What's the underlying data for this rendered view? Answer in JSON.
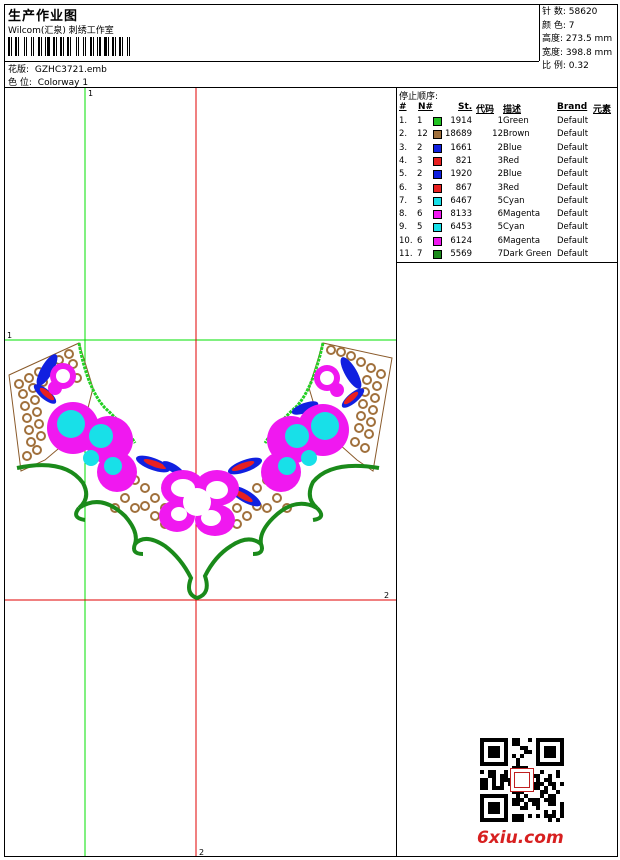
{
  "header": {
    "title": "生产作业图",
    "company": "Wilcom(汇泉) 刺绣工作室",
    "design_label": "花版:",
    "design_value": "GZHC3721.emb",
    "colorway_label": "色 位:",
    "colorway_value": "Colorway 1"
  },
  "stats": [
    {
      "label": "针 数:",
      "value": "58620"
    },
    {
      "label": "颜 色:",
      "value": "7"
    },
    {
      "label": "高度:",
      "value": "273.5 mm"
    },
    {
      "label": "宽度:",
      "value": "398.8 mm"
    },
    {
      "label": "比 例:",
      "value": "0.32"
    }
  ],
  "sequence": {
    "title": "停止顺序:",
    "headers": {
      "num": "#",
      "n": "N#",
      "st": "St.",
      "code": "代码",
      "desc": "描述",
      "brand": "Brand",
      "elem": "元素"
    },
    "rows": [
      {
        "num": "1.",
        "n": "1",
        "color": "#22c322",
        "st": "1914",
        "code": "1",
        "desc": "Green",
        "brand": "Default"
      },
      {
        "num": "2.",
        "n": "12",
        "color": "#a0703c",
        "st": "18689",
        "code": "12",
        "desc": "Brown",
        "brand": "Default"
      },
      {
        "num": "3.",
        "n": "2",
        "color": "#1020e0",
        "st": "1661",
        "code": "2",
        "desc": "Blue",
        "brand": "Default"
      },
      {
        "num": "4.",
        "n": "3",
        "color": "#e82020",
        "st": "821",
        "code": "3",
        "desc": "Red",
        "brand": "Default"
      },
      {
        "num": "5.",
        "n": "2",
        "color": "#1020e0",
        "st": "1920",
        "code": "2",
        "desc": "Blue",
        "brand": "Default"
      },
      {
        "num": "6.",
        "n": "3",
        "color": "#e82020",
        "st": "867",
        "code": "3",
        "desc": "Red",
        "brand": "Default"
      },
      {
        "num": "7.",
        "n": "5",
        "color": "#18e0e8",
        "st": "6467",
        "code": "5",
        "desc": "Cyan",
        "brand": "Default"
      },
      {
        "num": "8.",
        "n": "6",
        "color": "#f018f0",
        "st": "8133",
        "code": "6",
        "desc": "Magenta",
        "brand": "Default"
      },
      {
        "num": "9.",
        "n": "5",
        "color": "#18e0e8",
        "st": "6453",
        "code": "5",
        "desc": "Cyan",
        "brand": "Default"
      },
      {
        "num": "10.",
        "n": "6",
        "color": "#f018f0",
        "st": "6124",
        "code": "6",
        "desc": "Magenta",
        "brand": "Default"
      },
      {
        "num": "11.",
        "n": "7",
        "color": "#1a8a1a",
        "st": "5569",
        "code": "7",
        "desc": "Dark Green",
        "brand": "Default"
      }
    ]
  },
  "guides": {
    "v1": "1",
    "h1": "1",
    "h2": "2",
    "v2": "2"
  },
  "watermark": "6xiu.com",
  "colors": {
    "green_guide": "#00e000",
    "red_guide": "#e00000"
  }
}
